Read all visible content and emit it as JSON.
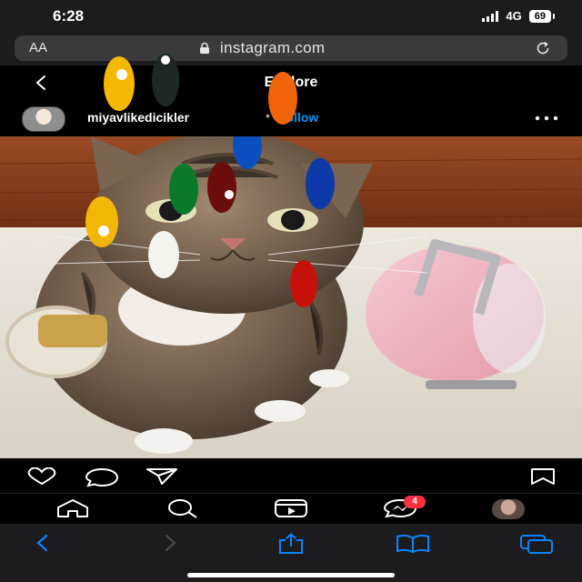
{
  "status_bar": {
    "time": "6:28",
    "network": "4G",
    "battery": "69"
  },
  "browser": {
    "text_size_label": "AA",
    "url": "instagram.com"
  },
  "header": {
    "title": "Explore"
  },
  "post": {
    "username": "miyavlikedicikler",
    "separator": "•",
    "follow_label": "Follow"
  },
  "nav": {
    "notification_count": "4"
  },
  "icons": {
    "back": "chevron-left",
    "lock": "lock",
    "reload": "reload",
    "more": "ellipsis",
    "like": "heart",
    "comment": "speech-bubble",
    "share": "paper-plane",
    "save": "bookmark",
    "home": "house",
    "search": "magnifier",
    "reels": "clapperboard",
    "messenger": "messenger-bubble",
    "safari_back": "chevron-left",
    "safari_forward": "chevron-right",
    "safari_share": "share-box",
    "safari_bookmarks": "open-book",
    "safari_tabs": "overlapping-squares"
  },
  "colors": {
    "follow": "#0095f6",
    "badge": "#ff3040",
    "safari_blue": "#0a84ff"
  }
}
